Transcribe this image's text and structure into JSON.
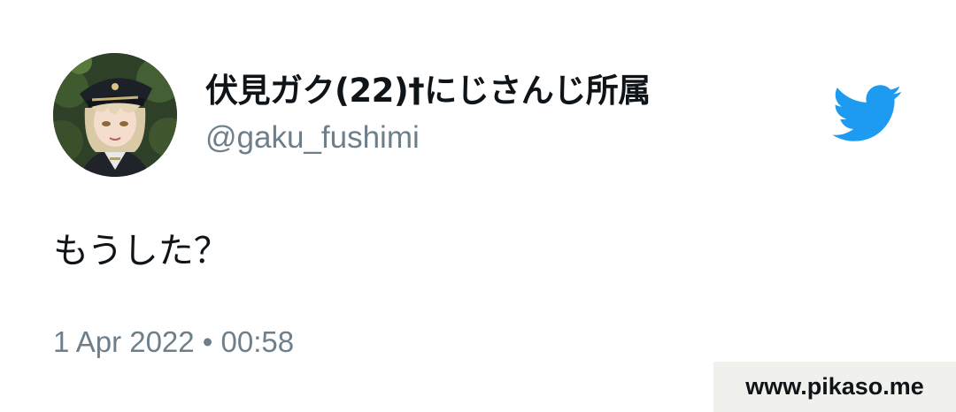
{
  "tweet": {
    "display_name": "伏見ガク(22)†にじさんじ所属",
    "handle": "@gaku_fushimi",
    "text": "もうした？",
    "timestamp": "1 Apr 2022 • 00:58"
  },
  "watermark": {
    "text": "www.pikaso.me"
  },
  "icons": {
    "brand": "twitter-bird-icon",
    "brand_color": "#1d9bf0"
  },
  "colors": {
    "primary_text": "#0f1419",
    "secondary_text": "#6e7f8c",
    "background": "#ffffff",
    "watermark_bg": "#f0f0ec"
  }
}
